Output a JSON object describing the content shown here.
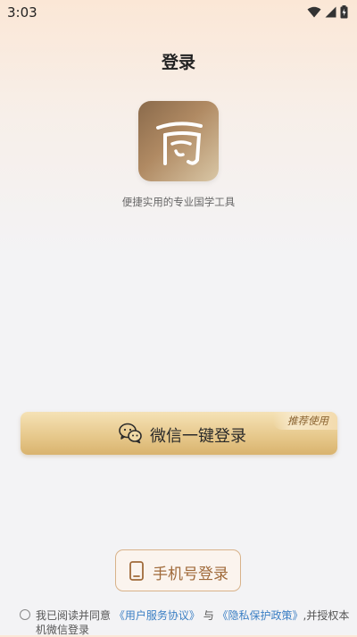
{
  "status_bar": {
    "time": "3:03",
    "icons": [
      "wifi-icon",
      "cellular-signal-icon",
      "battery-charging-icon"
    ]
  },
  "header": {
    "title": "登录"
  },
  "app": {
    "logo_icon": "app-logo-icon",
    "tagline": "便捷实用的专业国学工具"
  },
  "wechat_login": {
    "icon": "wechat-icon",
    "label": "微信一键登录",
    "tag": "推荐使用"
  },
  "phone_login": {
    "icon": "phone-icon",
    "label": "手机号登录"
  },
  "agreement": {
    "prefix": "我已阅读并同意",
    "user_agreement": "《用户服务协议》",
    "and": "与",
    "privacy_policy": "《隐私保护政策》",
    "suffix": ",并授权本机微信登录"
  },
  "colors": {
    "accent_gold": "#e7c98d",
    "link_blue": "#3b7fc4",
    "phone_text": "#a06a3a"
  }
}
